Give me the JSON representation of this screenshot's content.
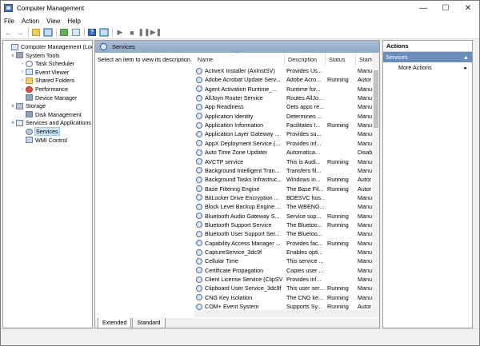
{
  "window": {
    "title": "Computer Management"
  },
  "menu": [
    "File",
    "Action",
    "View",
    "Help"
  ],
  "tree": [
    {
      "label": "Computer Management (Local",
      "level": 0,
      "expander": "",
      "icon": "computer-icon"
    },
    {
      "label": "System Tools",
      "level": 1,
      "expander": "v",
      "icon": "tools-icon"
    },
    {
      "label": "Task Scheduler",
      "level": 2,
      "expander": ">",
      "icon": "clock-icon"
    },
    {
      "label": "Event Viewer",
      "level": 2,
      "expander": ">",
      "icon": "event-icon"
    },
    {
      "label": "Shared Folders",
      "level": 2,
      "expander": ">",
      "icon": "share-icon"
    },
    {
      "label": "Performance",
      "level": 2,
      "expander": ">",
      "icon": "perf-icon"
    },
    {
      "label": "Device Manager",
      "level": 2,
      "expander": "",
      "icon": "device-icon"
    },
    {
      "label": "Storage",
      "level": 1,
      "expander": "v",
      "icon": "storage-icon"
    },
    {
      "label": "Disk Management",
      "level": 2,
      "expander": "",
      "icon": "disk-icon"
    },
    {
      "label": "Services and Applications",
      "level": 1,
      "expander": "v",
      "icon": "services-apps-icon"
    },
    {
      "label": "Services",
      "level": 2,
      "expander": "",
      "icon": "gear-icon",
      "selected": true
    },
    {
      "label": "WMI Control",
      "level": 2,
      "expander": "",
      "icon": "wmi-icon"
    }
  ],
  "middle": {
    "header": "Services",
    "description": "Select an item to view its description.",
    "columns": {
      "name": "Name",
      "description": "Description",
      "status": "Status",
      "startup": "Startu"
    },
    "services": [
      {
        "name": "ActiveX Installer (AxInstSV)",
        "desc": "Provides Us...",
        "status": "",
        "startup": "Manu"
      },
      {
        "name": "Adobe Acrobat Update Serv...",
        "desc": "Adobe Acro...",
        "status": "Running",
        "startup": "Autor"
      },
      {
        "name": "Agent Activation Runtime_...",
        "desc": "Runtime for...",
        "status": "",
        "startup": "Manu"
      },
      {
        "name": "AllJoyn Router Service",
        "desc": "Routes AllJo...",
        "status": "",
        "startup": "Manu"
      },
      {
        "name": "App Readiness",
        "desc": "Gets apps re...",
        "status": "",
        "startup": "Manu"
      },
      {
        "name": "Application Identity",
        "desc": "Determines ...",
        "status": "",
        "startup": "Manu"
      },
      {
        "name": "Application Information",
        "desc": "Facilitates t...",
        "status": "Running",
        "startup": "Manu"
      },
      {
        "name": "Application Layer Gateway ...",
        "desc": "Provides su...",
        "status": "",
        "startup": "Manu"
      },
      {
        "name": "AppX Deployment Service (...",
        "desc": "Provides inf...",
        "status": "",
        "startup": "Manu"
      },
      {
        "name": "Auto Time Zone Updater",
        "desc": "Automatica...",
        "status": "",
        "startup": "Disab"
      },
      {
        "name": "AVCTP service",
        "desc": "This is Audi...",
        "status": "Running",
        "startup": "Manu"
      },
      {
        "name": "Background Intelligent Tran...",
        "desc": "Transfers fil...",
        "status": "",
        "startup": "Manu"
      },
      {
        "name": "Background Tasks Infrastruc...",
        "desc": "Windows in...",
        "status": "Running",
        "startup": "Autor"
      },
      {
        "name": "Base Filtering Engine",
        "desc": "The Base Fil...",
        "status": "Running",
        "startup": "Autor"
      },
      {
        "name": "BitLocker Drive Encryption ...",
        "desc": "BDESVC hos...",
        "status": "",
        "startup": "Manu"
      },
      {
        "name": "Block Level Backup Engine ...",
        "desc": "The WBENG...",
        "status": "",
        "startup": "Manu"
      },
      {
        "name": "Bluetooth Audio Gateway S...",
        "desc": "Service sup...",
        "status": "Running",
        "startup": "Manu"
      },
      {
        "name": "Bluetooth Support Service",
        "desc": "The Bluetoo...",
        "status": "Running",
        "startup": "Manu"
      },
      {
        "name": "Bluetooth User Support Ser...",
        "desc": "The Bluetoo...",
        "status": "",
        "startup": "Manu"
      },
      {
        "name": "Capability Access Manager ...",
        "desc": "Provides fac...",
        "status": "Running",
        "startup": "Manu"
      },
      {
        "name": "CaptureService_3dc9f",
        "desc": "Enables opti...",
        "status": "",
        "startup": "Manu"
      },
      {
        "name": "Cellular Time",
        "desc": "This service ...",
        "status": "",
        "startup": "Manu"
      },
      {
        "name": "Certificate Propagation",
        "desc": "Copies user ...",
        "status": "",
        "startup": "Manu"
      },
      {
        "name": "Client License Service (ClipSVC)",
        "desc": "Provides inf...",
        "status": "",
        "startup": "Manu"
      },
      {
        "name": "Clipboard User Service_3dc9f",
        "desc": "This user ser...",
        "status": "Running",
        "startup": "Manu"
      },
      {
        "name": "CNG Key Isolation",
        "desc": "The CNG ke...",
        "status": "Running",
        "startup": "Manu"
      },
      {
        "name": "COM+ Event System",
        "desc": "Supports Sy...",
        "status": "Running",
        "startup": "Autor"
      }
    ],
    "tabs": [
      "Extended",
      "Standard"
    ]
  },
  "actions": {
    "title": "Actions",
    "section": "Services",
    "items": [
      {
        "label": "More Actions"
      }
    ]
  }
}
